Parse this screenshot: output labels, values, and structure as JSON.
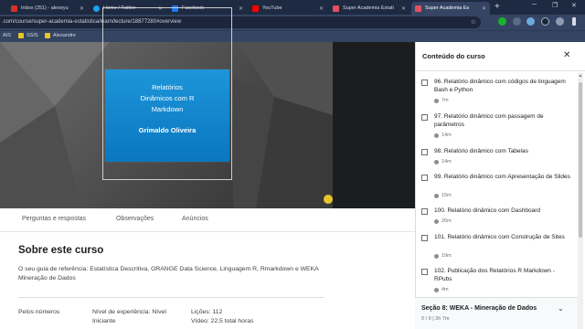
{
  "browser": {
    "tabs": [
      {
        "label": "Inbox (251) - alexeyu",
        "color": "#d93025"
      },
      {
        "label": "Home / Twitter",
        "color": "#1da1f2"
      },
      {
        "label": "Facebook",
        "color": "#1877f2"
      },
      {
        "label": "YouTube",
        "color": "#ff0000"
      },
      {
        "label": "Super Academia Estatí",
        "color": "#e0525f"
      },
      {
        "label": "Super Academia Es",
        "color": "#e0525f"
      }
    ],
    "new_tab": "+",
    "url": ".com/course/super-academia-estatistica/learn/lecture/18877280#overview",
    "bookmarks": [
      "AIS",
      "SSIS",
      "Alexandre"
    ]
  },
  "video": {
    "title_lines": [
      "Relatórios",
      "Dinâmicos com R",
      "Markdown"
    ],
    "author": "Grimaldo Oliveira"
  },
  "nav_tabs": [
    "Perguntas e respostas",
    "Observações",
    "Anúncios"
  ],
  "about": {
    "heading": "Sobre este curso",
    "description": "O seu guia de referência: Estatística Descritiva, ORANGE Data Science, Linguagem R, Rmarkdown e WEKA Mineração de Dados",
    "stats": {
      "numbers_label": "Pelos números",
      "level_label": "Nível de experiência: Nível",
      "level_value": "Iniciante",
      "lessons": "Lições: 112",
      "video": "Vídeo: 22,5 total horas"
    }
  },
  "sidebar": {
    "title": "Conteúdo do curso",
    "close_icon": "close-icon",
    "lectures": [
      {
        "title": "96. Relatório dinâmico com códigos de linguagem Bash e Python",
        "duration": "7m"
      },
      {
        "title": "97. Relatório dinâmico com passagem de parâmetros",
        "duration": "14m"
      },
      {
        "title": "98. Relatório dinâmico com Tabelas",
        "duration": "14m"
      },
      {
        "title": "99. Relatório dinâmico com Apresentação de Slides",
        "duration": "15m"
      },
      {
        "title": "100. Relatório dinâmico com Dashboard",
        "duration": "20m"
      },
      {
        "title": "101. Relatório dinâmico com Construção de Sites",
        "duration": "19m"
      },
      {
        "title": "102. Publicação dos Relatórios R Markdown - RPubs",
        "duration": "4m"
      }
    ],
    "section": {
      "title": "Seção 8: WEKA - Mineração de Dados",
      "subtitle": "0 / 9 | 2h 7m"
    }
  }
}
